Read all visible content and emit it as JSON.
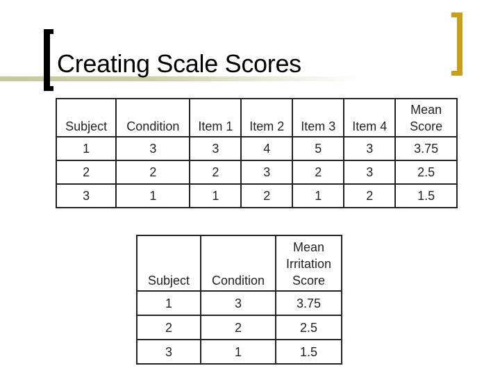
{
  "slide": {
    "title": "Creating Scale Scores",
    "accent_color": "#c9a01c",
    "line_color": "#c9c89c"
  },
  "table1": {
    "headers": [
      "Subject",
      "Condition",
      "Item 1",
      "Item 2",
      "Item 3",
      "Item 4",
      "Mean Score"
    ],
    "rows": [
      [
        "1",
        "3",
        "3",
        "4",
        "5",
        "3",
        "3.75"
      ],
      [
        "2",
        "2",
        "2",
        "3",
        "2",
        "3",
        "2.5"
      ],
      [
        "3",
        "1",
        "1",
        "2",
        "1",
        "2",
        "1.5"
      ]
    ]
  },
  "table2": {
    "headers": [
      "Subject",
      "Condition",
      "Mean Irritation Score"
    ],
    "rows": [
      [
        "1",
        "3",
        "3.75"
      ],
      [
        "2",
        "2",
        "2.5"
      ],
      [
        "3",
        "1",
        "1.5"
      ]
    ]
  }
}
